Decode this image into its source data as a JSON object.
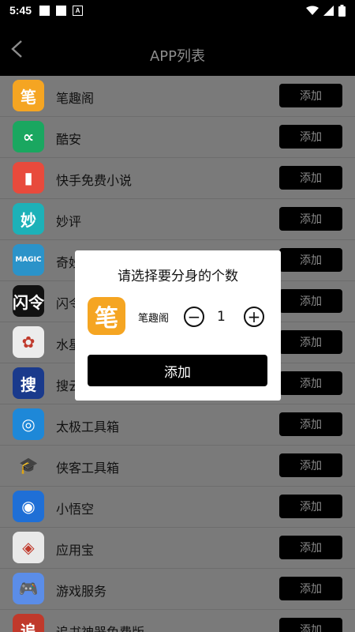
{
  "status_bar": {
    "time": "5:45",
    "notification_icons": [
      "square-icon",
      "square-icon",
      "a-badge-icon"
    ],
    "a_badge_label": "A",
    "right_icons": [
      "wifi-icon",
      "signal-icon",
      "battery-icon"
    ]
  },
  "app_bar": {
    "title": "APP列表",
    "back_icon": "chevron-left-icon"
  },
  "apps": [
    {
      "name": "笔趣阁",
      "icon_glyph": "笔",
      "icon_color": "#f5a522",
      "add_label": "添加"
    },
    {
      "name": "酷安",
      "icon_glyph": "∝",
      "icon_color": "#1aa760",
      "add_label": "添加"
    },
    {
      "name": "快手免费小说",
      "icon_glyph": "▮",
      "icon_color": "#e84a3c",
      "add_label": "添加"
    },
    {
      "name": "妙评",
      "icon_glyph": "妙",
      "icon_color": "#1db1b8",
      "add_label": "添加"
    },
    {
      "name": "奇妙",
      "icon_glyph": "MAGIC",
      "icon_color": "#2b93c9",
      "add_label": "添加"
    },
    {
      "name": "闪令",
      "icon_glyph": "闪令",
      "icon_color": "#111111",
      "add_label": "添加"
    },
    {
      "name": "水星",
      "icon_glyph": "✿",
      "icon_color": "#ececec",
      "add_label": "添加"
    },
    {
      "name": "搜云",
      "icon_glyph": "搜",
      "icon_color": "#1a3a8c",
      "add_label": "添加"
    },
    {
      "name": "太极工具箱",
      "icon_glyph": "◎",
      "icon_color": "#1e88d8",
      "add_label": "添加"
    },
    {
      "name": "侠客工具箱",
      "icon_glyph": "🎓",
      "icon_color": "#7a7a7a",
      "add_label": "添加"
    },
    {
      "name": "小悟空",
      "icon_glyph": "◉",
      "icon_color": "#1f6fd6",
      "add_label": "添加"
    },
    {
      "name": "应用宝",
      "icon_glyph": "◈",
      "icon_color": "#e9e9e9",
      "add_label": "添加"
    },
    {
      "name": "游戏服务",
      "icon_glyph": "🎮",
      "icon_color": "#5b8de8",
      "add_label": "添加"
    },
    {
      "name": "追书神器免费版",
      "icon_glyph": "追",
      "icon_color": "#c0392b",
      "add_label": "添加"
    }
  ],
  "dialog": {
    "title": "请选择要分身的个数",
    "app_name": "笔趣阁",
    "app_icon_glyph": "笔",
    "minus_label": "−",
    "plus_label": "+",
    "quantity": "1",
    "confirm_label": "添加"
  }
}
